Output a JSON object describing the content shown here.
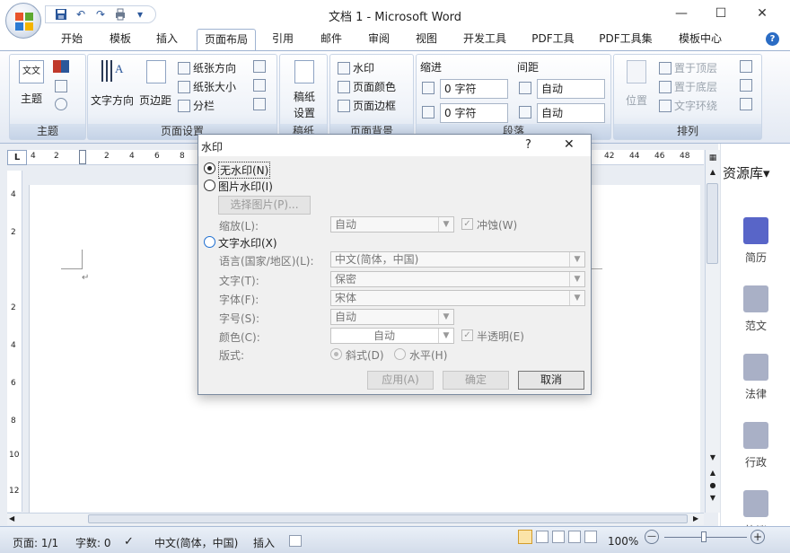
{
  "window": {
    "title": "文档 1 - Microsoft Word",
    "controls": {
      "minimize": "—",
      "maximize": "☐",
      "close": "✕"
    }
  },
  "qat": {
    "items": [
      "save-icon",
      "undo-icon",
      "redo-icon",
      "print-icon",
      "customize-icon"
    ],
    "undo": "↶",
    "redo": "↷",
    "more": "▾"
  },
  "tabs": [
    {
      "label": "开始"
    },
    {
      "label": "模板"
    },
    {
      "label": "插入"
    },
    {
      "label": "页面布局",
      "active": true
    },
    {
      "label": "引用"
    },
    {
      "label": "邮件"
    },
    {
      "label": "审阅"
    },
    {
      "label": "视图"
    },
    {
      "label": "开发工具"
    },
    {
      "label": "PDF工具"
    },
    {
      "label": "PDF工具集"
    },
    {
      "label": "模板中心"
    }
  ],
  "help_icon": "?",
  "ribbon": {
    "groups": {
      "theme": {
        "label": "主题",
        "theme_btn": "主题",
        "icon_text": "文文"
      },
      "page_setup": {
        "label": "页面设置",
        "text_direction": "文字方向",
        "margins": "页边距",
        "orientation": "纸张方向",
        "size": "纸张大小",
        "columns": "分栏"
      },
      "draft": {
        "label": "稿纸",
        "btn": "稿纸\n设置",
        "btn_line1": "稿纸",
        "btn_line2": "设置"
      },
      "page_bg": {
        "label": "页面背景",
        "watermark": "水印",
        "page_color": "页面颜色",
        "page_border": "页面边框"
      },
      "paragraph": {
        "label": "段落",
        "indent_title": "缩进",
        "spacing_title": "间距",
        "indent_left": "0 字符",
        "indent_right": "0 字符",
        "spacing_before": "自动",
        "spacing_after": "自动"
      },
      "arrange": {
        "label": "排列",
        "position": "位置",
        "bring_front": "置于顶层",
        "send_back": "置于底层",
        "wrap_text": "文字环绕"
      }
    }
  },
  "ruler": {
    "box_label": "L",
    "h_ticks_left": [
      "4",
      "2",
      "2",
      "4",
      "6",
      "8"
    ],
    "h_ticks_right": [
      "42",
      "44",
      "46",
      "48"
    ],
    "v_ticks": [
      "4",
      "2",
      "2",
      "4",
      "6",
      "8",
      "10",
      "12"
    ]
  },
  "side_panel": {
    "title": "资源库",
    "title_arrow": "▾",
    "items": [
      {
        "label": "简历"
      },
      {
        "label": "范文"
      },
      {
        "label": "法律"
      },
      {
        "label": "行政"
      },
      {
        "label": "协议"
      }
    ]
  },
  "status_bar": {
    "page": "页面: 1/1",
    "words": "字数: 0",
    "language": "中文(简体，中国)",
    "insert": "插入",
    "zoom": "100%",
    "zoom_minus": "—",
    "zoom_plus": "+"
  },
  "dialog": {
    "title": "水印",
    "help": "?",
    "close": "✕",
    "no_watermark": "无水印(N)",
    "picture_watermark": "图片水印(I)",
    "select_picture": "选择图片(P)...",
    "scale_label": "缩放(L):",
    "scale_value": "自动",
    "washout_label": "冲蚀(W)",
    "text_watermark": "文字水印(X)",
    "language_label": "语言(国家/地区)(L):",
    "language_value": "中文(简体，中国)",
    "text_label": "文字(T):",
    "text_value": "保密",
    "font_label": "字体(F):",
    "font_value": "宋体",
    "size_label": "字号(S):",
    "size_value": "自动",
    "color_label": "颜色(C):",
    "color_value": "自动",
    "semitransparent_label": "半透明(E)",
    "layout_label": "版式:",
    "diagonal": "斜式(D)",
    "horizontal": "水平(H)",
    "apply_button": "应用(A)",
    "ok_button": "确定",
    "cancel_button": "取消"
  },
  "colors": {
    "accent": "#2b579a",
    "ribbon_border": "#9fb3d1",
    "side_icon": "#7b87b8"
  }
}
